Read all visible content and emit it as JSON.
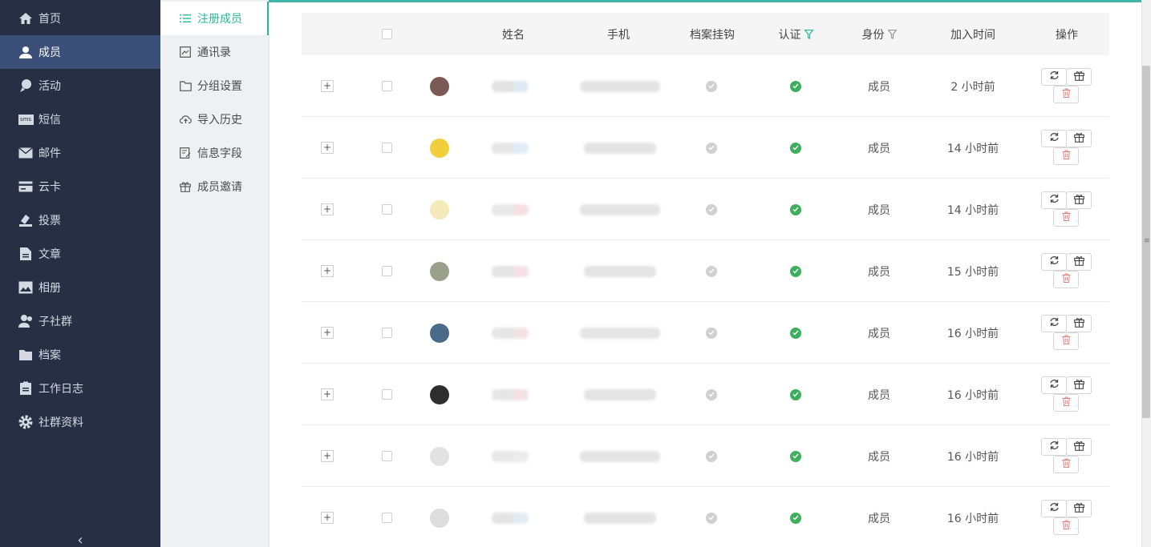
{
  "nav": {
    "items": [
      {
        "label": "首页",
        "icon": "home-icon"
      },
      {
        "label": "成员",
        "icon": "member-icon"
      },
      {
        "label": "活动",
        "icon": "activity-icon"
      },
      {
        "label": "短信",
        "icon": "sms-icon"
      },
      {
        "label": "邮件",
        "icon": "mail-icon"
      },
      {
        "label": "云卡",
        "icon": "card-icon"
      },
      {
        "label": "投票",
        "icon": "vote-icon"
      },
      {
        "label": "文章",
        "icon": "article-icon"
      },
      {
        "label": "相册",
        "icon": "album-icon"
      },
      {
        "label": "子社群",
        "icon": "subgroup-icon"
      },
      {
        "label": "档案",
        "icon": "archive-icon"
      },
      {
        "label": "工作日志",
        "icon": "worklog-icon"
      },
      {
        "label": "社群资料",
        "icon": "settings-icon"
      }
    ],
    "active_index": 1,
    "sms_icon_text": "sms",
    "collapse_glyph": "‹"
  },
  "submenu": {
    "items": [
      {
        "label": "注册成员",
        "icon": "list-icon"
      },
      {
        "label": "通讯录",
        "icon": "contacts-icon"
      },
      {
        "label": "分组设置",
        "icon": "folder-icon"
      },
      {
        "label": "导入历史",
        "icon": "cloud-upload-icon"
      },
      {
        "label": "信息字段",
        "icon": "form-icon"
      },
      {
        "label": "成员邀请",
        "icon": "gift-icon"
      }
    ],
    "active_index": 0
  },
  "table": {
    "headers": {
      "name": "姓名",
      "phone": "手机",
      "archive": "档案挂钩",
      "verified": "认证",
      "role": "身份",
      "joined": "加入时间",
      "ops": "操作"
    },
    "rows": [
      {
        "expand": "+",
        "role": "成员",
        "joined": "2 小时前",
        "archive_linked": false,
        "verified": true,
        "avatar": "#7a5a55"
      },
      {
        "expand": "+",
        "role": "成员",
        "joined": "14 小时前",
        "archive_linked": false,
        "verified": true,
        "avatar": "#f0cf3a"
      },
      {
        "expand": "+",
        "role": "成员",
        "joined": "14 小时前",
        "archive_linked": false,
        "verified": true,
        "avatar": "#f4e9b8"
      },
      {
        "expand": "+",
        "role": "成员",
        "joined": "15 小时前",
        "archive_linked": false,
        "verified": true,
        "avatar": "#9aa08a"
      },
      {
        "expand": "+",
        "role": "成员",
        "joined": "16 小时前",
        "archive_linked": false,
        "verified": true,
        "avatar": "#4a6a8a"
      },
      {
        "expand": "+",
        "role": "成员",
        "joined": "16 小时前",
        "archive_linked": false,
        "verified": true,
        "avatar": "#2e2e2e"
      },
      {
        "expand": "+",
        "role": "成员",
        "joined": "16 小时前",
        "archive_linked": false,
        "verified": true,
        "avatar": "#e2e2e2"
      },
      {
        "expand": "+",
        "role": "成员",
        "joined": "16 小时前",
        "archive_linked": false,
        "verified": true,
        "avatar": "#dddddd"
      }
    ]
  },
  "colors": {
    "accent": "#26b99a",
    "nav_bg": "#262f44",
    "nav_active": "#3b4f79",
    "verified": "#3eaf5c",
    "delete": "#e0807a"
  }
}
